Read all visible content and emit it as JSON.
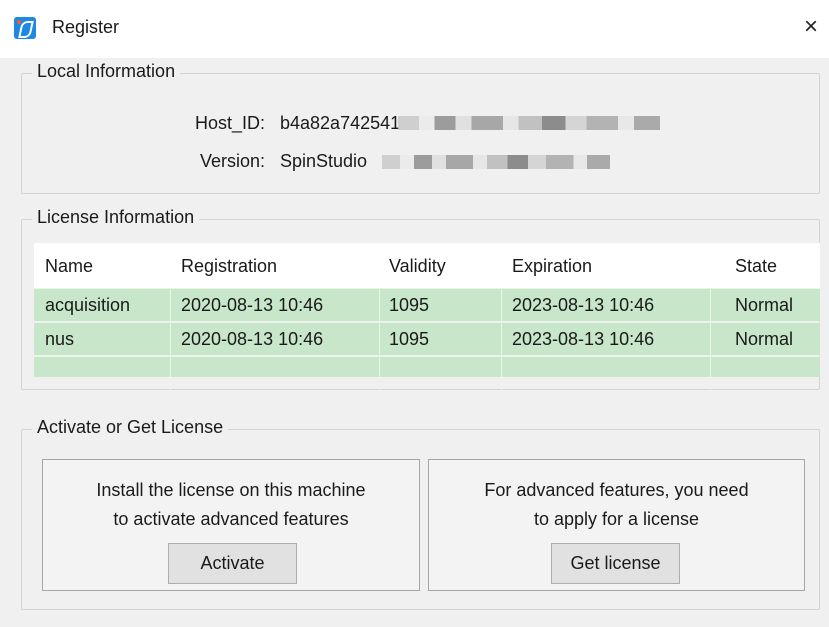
{
  "window": {
    "title": "Register",
    "icon": "app-icon",
    "close_glyph": "×"
  },
  "local_info": {
    "legend": "Local Information",
    "host_id_label": "Host_ID:",
    "host_id_value": "b4a82a742541",
    "version_label": "Version:",
    "version_value": "SpinStudio"
  },
  "license_info": {
    "legend": "License Information",
    "columns": [
      "Name",
      "Registration",
      "Validity",
      "Expiration",
      "State"
    ],
    "rows": [
      [
        "acquisition",
        "2020-08-13 10:46",
        "1095",
        "2023-08-13 10:46",
        "Normal"
      ],
      [
        "nus",
        "2020-08-13 10:46",
        "1095",
        "2023-08-13 10:46",
        "Normal"
      ],
      [
        "",
        "",
        "",
        "",
        ""
      ]
    ]
  },
  "activate": {
    "legend": "Activate or Get License",
    "left_line1": "Install the license on this machine",
    "left_line2": "to activate advanced features",
    "activate_button": "Activate",
    "right_line1": "For advanced features, you need",
    "right_line2": "to apply for a license",
    "get_license_button": "Get license"
  },
  "colors": {
    "row_bg": "#c8e6c9",
    "accent": "#1e88e5"
  }
}
